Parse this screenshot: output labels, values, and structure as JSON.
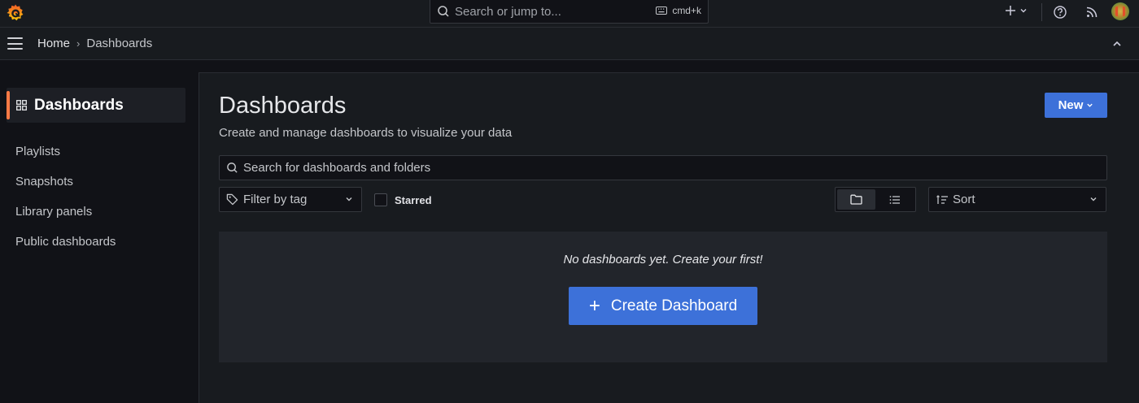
{
  "topbar": {
    "logo_icon": "grafana-logo-icon",
    "search": {
      "placeholder": "Search or jump to...",
      "shortcut": "cmd+k"
    },
    "icons": [
      "plus-icon",
      "chevron-down-icon",
      "help-icon",
      "rss-icon",
      "user-avatar"
    ]
  },
  "breadcrumb": {
    "home": "Home",
    "separator": "›",
    "current": "Dashboards"
  },
  "sidebar": {
    "active": {
      "label": "Dashboards",
      "icon": "apps-grid-icon"
    },
    "items": [
      {
        "label": "Playlists"
      },
      {
        "label": "Snapshots"
      },
      {
        "label": "Library panels"
      },
      {
        "label": "Public dashboards"
      }
    ]
  },
  "main": {
    "title": "Dashboards",
    "subtitle": "Create and manage dashboards to visualize your data",
    "new_button": "New",
    "search_placeholder": "Search for dashboards and folders",
    "tag_filter_placeholder": "Filter by tag",
    "starred_label": "Starred",
    "starred_checked": false,
    "view_mode": "folder",
    "sort_label": "Sort",
    "empty_message": "No dashboards yet. Create your first!",
    "create_button": "Create Dashboard"
  },
  "colors": {
    "accent_primary": "#3d71d9",
    "active_indicator": "#ff7a45",
    "background": "#111217",
    "panel": "#181b1f"
  }
}
